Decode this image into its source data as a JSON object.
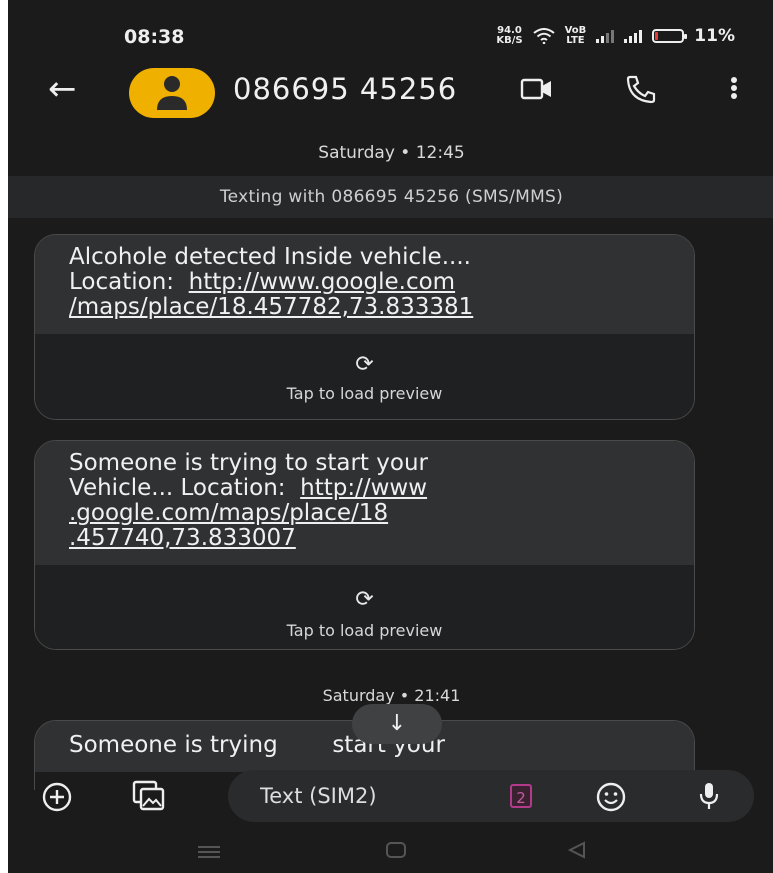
{
  "status_bar": {
    "time": "08:38",
    "net_speed_value": "94.0",
    "net_speed_unit": "KB/S",
    "volte_top": "VoB",
    "volte_bottom": "LTE",
    "battery_percent": "11%",
    "battery_level": 0.11,
    "battery_color": "#e23b3b"
  },
  "header": {
    "contact_name": "086695 45256",
    "avatar_color": "#f0b000",
    "icons": [
      "back-arrow-icon",
      "person-icon",
      "video-call-icon",
      "phone-icon",
      "more-vert-icon"
    ]
  },
  "conversation": {
    "date_separator_1": "Saturday • 12:45",
    "texting_info": "Texting with 086695 45256 (SMS/MMS)",
    "messages": [
      {
        "line1": "Alcohole detected Inside vehicle....",
        "line2_prefix": "Location:",
        "link_part1": "http://www.google.com",
        "link_part2": "/maps/place/18.457782,73.833381",
        "preview_icon": "refresh-icon",
        "preview_label": "Tap to load preview"
      },
      {
        "line1": "Someone is trying to start your",
        "line2_prefix": "Vehicle... Location:",
        "link_part1": "http://www",
        "link_part2": ".google.com/maps/place/18",
        "link_part3": ".457740,73.833007",
        "preview_icon": "refresh-icon",
        "preview_label": "Tap to load preview"
      }
    ],
    "date_separator_2": "Saturday • 21:41",
    "partial_message": {
      "line1_a": "Someone is trying",
      "line1_b": "start your"
    },
    "scroll_down_icon": "arrow-down-icon"
  },
  "composer": {
    "placeholder": "Text (SIM2)",
    "sim_badge": "2",
    "sim_badge_color": "#b23a8a",
    "icons": [
      "add-circle-icon",
      "gallery-icon",
      "emoji-icon",
      "mic-icon"
    ]
  },
  "nav_bar": {
    "icons": [
      "menu-icon",
      "home-icon",
      "back-triangle-icon"
    ]
  }
}
